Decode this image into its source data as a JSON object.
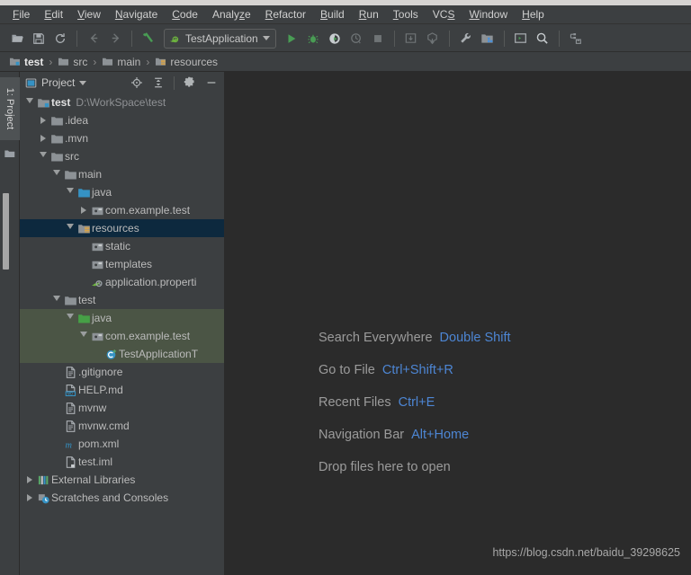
{
  "menubar": {
    "items": [
      {
        "label": "File",
        "mnemonic": "F"
      },
      {
        "label": "Edit",
        "mnemonic": "E"
      },
      {
        "label": "View",
        "mnemonic": "V"
      },
      {
        "label": "Navigate",
        "mnemonic": "N"
      },
      {
        "label": "Code",
        "mnemonic": "C"
      },
      {
        "label": "Analyze",
        "mnemonic": "z"
      },
      {
        "label": "Refactor",
        "mnemonic": "R"
      },
      {
        "label": "Build",
        "mnemonic": "B"
      },
      {
        "label": "Run",
        "mnemonic": "R"
      },
      {
        "label": "Tools",
        "mnemonic": "T"
      },
      {
        "label": "VCS",
        "mnemonic": "S"
      },
      {
        "label": "Window",
        "mnemonic": "W"
      },
      {
        "label": "Help",
        "mnemonic": "H"
      }
    ]
  },
  "toolbar": {
    "icons_left": [
      "open-folder-icon",
      "save-all-icon",
      "sync-refresh-icon"
    ],
    "nav_icons": [
      "back-arrow-icon",
      "forward-arrow-icon"
    ],
    "build_icon": "build-hammer-icon",
    "run_config": {
      "name": "TestApplication",
      "icon": "spring-boot-icon",
      "caret": "chevron-down-icon"
    },
    "icons_right": [
      "run-icon",
      "debug-icon",
      "run-with-coverage-icon",
      "profile-icon",
      "stop-icon",
      "update-project-icon",
      "commit-icon",
      "settings-wrench-icon",
      "project-structure-icon",
      "terminal-icon",
      "search-icon",
      "database-save-icon"
    ]
  },
  "breadcrumb": {
    "items": [
      {
        "label": "test",
        "icon": "module-icon"
      },
      {
        "label": "src",
        "icon": "folder-icon"
      },
      {
        "label": "main",
        "icon": "folder-icon"
      },
      {
        "label": "resources",
        "icon": "resources-folder-icon"
      }
    ],
    "separator": "›"
  },
  "toolstrip": {
    "tab_label": "1: Project",
    "icon": "project-folder-icon"
  },
  "panel": {
    "title": "Project",
    "title_icon": "project-view-icon",
    "caret": "chevron-down-icon",
    "buttons": [
      "locate-target-icon",
      "collapse-all-icon",
      "settings-gear-icon",
      "hide-minimize-icon"
    ]
  },
  "tree": {
    "nodes": [
      {
        "name": "test",
        "sub": "D:\\WorkSpace\\test",
        "depth": 0,
        "twisty": "open",
        "icon": "module-icon",
        "bold": true,
        "state": "normal"
      },
      {
        "name": ".idea",
        "sub": "",
        "depth": 1,
        "twisty": "closed",
        "icon": "folder-icon",
        "bold": false,
        "state": "normal"
      },
      {
        "name": ".mvn",
        "sub": "",
        "depth": 1,
        "twisty": "closed",
        "icon": "folder-icon",
        "bold": false,
        "state": "normal"
      },
      {
        "name": "src",
        "sub": "",
        "depth": 1,
        "twisty": "open",
        "icon": "folder-icon",
        "bold": false,
        "state": "normal"
      },
      {
        "name": "main",
        "sub": "",
        "depth": 2,
        "twisty": "open",
        "icon": "folder-icon",
        "bold": false,
        "state": "normal"
      },
      {
        "name": "java",
        "sub": "",
        "depth": 3,
        "twisty": "open",
        "icon": "source-root-icon",
        "bold": false,
        "state": "normal"
      },
      {
        "name": "com.example.test",
        "sub": "",
        "depth": 4,
        "twisty": "closed",
        "icon": "package-icon",
        "bold": false,
        "state": "normal"
      },
      {
        "name": "resources",
        "sub": "",
        "depth": 3,
        "twisty": "open",
        "icon": "resources-folder-icon",
        "bold": false,
        "state": "selected"
      },
      {
        "name": "static",
        "sub": "",
        "depth": 4,
        "twisty": "none",
        "icon": "package-icon",
        "bold": false,
        "state": "normal"
      },
      {
        "name": "templates",
        "sub": "",
        "depth": 4,
        "twisty": "none",
        "icon": "package-icon",
        "bold": false,
        "state": "normal"
      },
      {
        "name": "application.properti",
        "sub": "",
        "depth": 4,
        "twisty": "none",
        "icon": "spring-properties-icon",
        "bold": false,
        "state": "normal"
      },
      {
        "name": "test",
        "sub": "",
        "depth": 2,
        "twisty": "open",
        "icon": "folder-icon",
        "bold": false,
        "state": "normal"
      },
      {
        "name": "java",
        "sub": "",
        "depth": 3,
        "twisty": "open",
        "icon": "test-source-root-icon",
        "bold": false,
        "state": "testsrc"
      },
      {
        "name": "com.example.test",
        "sub": "",
        "depth": 4,
        "twisty": "open",
        "icon": "package-icon",
        "bold": false,
        "state": "testsrc"
      },
      {
        "name": "TestApplicationT",
        "sub": "",
        "depth": 5,
        "twisty": "none",
        "icon": "java-class-icon",
        "bold": false,
        "state": "testsrc"
      },
      {
        "name": ".gitignore",
        "sub": "",
        "depth": 2,
        "twisty": "none",
        "icon": "file-text-icon",
        "bold": false,
        "state": "normal"
      },
      {
        "name": "HELP.md",
        "sub": "",
        "depth": 2,
        "twisty": "none",
        "icon": "markdown-icon",
        "bold": false,
        "state": "normal"
      },
      {
        "name": "mvnw",
        "sub": "",
        "depth": 2,
        "twisty": "none",
        "icon": "file-text-icon",
        "bold": false,
        "state": "normal"
      },
      {
        "name": "mvnw.cmd",
        "sub": "",
        "depth": 2,
        "twisty": "none",
        "icon": "file-text-icon",
        "bold": false,
        "state": "normal"
      },
      {
        "name": "pom.xml",
        "sub": "",
        "depth": 2,
        "twisty": "none",
        "icon": "maven-icon",
        "bold": false,
        "state": "normal"
      },
      {
        "name": "test.iml",
        "sub": "",
        "depth": 2,
        "twisty": "none",
        "icon": "iml-file-icon",
        "bold": false,
        "state": "normal"
      },
      {
        "name": "External Libraries",
        "sub": "",
        "depth": 0,
        "twisty": "closed",
        "icon": "libraries-icon",
        "bold": false,
        "state": "normal"
      },
      {
        "name": "Scratches and Consoles",
        "sub": "",
        "depth": 0,
        "twisty": "closed",
        "icon": "scratches-icon",
        "bold": false,
        "state": "normal"
      }
    ]
  },
  "editor": {
    "hints": [
      {
        "action": "Search Everywhere",
        "shortcut": "Double Shift"
      },
      {
        "action": "Go to File",
        "shortcut": "Ctrl+Shift+R"
      },
      {
        "action": "Recent Files",
        "shortcut": "Ctrl+E"
      },
      {
        "action": "Navigation Bar",
        "shortcut": "Alt+Home"
      },
      {
        "action": "Drop files here to open",
        "shortcut": ""
      }
    ],
    "watermark": "https://blog.csdn.net/baidu_39298625"
  },
  "colors": {
    "chrome": "#3c3f41",
    "editor_bg": "#2b2b2b",
    "selection": "#0d293e",
    "test_source": "#4b5545",
    "accent_blue": "#4d86d4",
    "green": "#499c54",
    "text": "#bbbbbb"
  }
}
